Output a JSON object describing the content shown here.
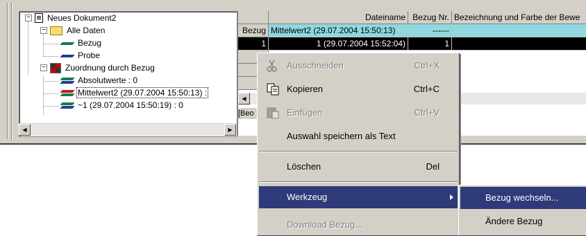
{
  "tree": {
    "nodes": [
      {
        "label": "Neues Dokument2",
        "icon": "document-icon"
      },
      {
        "label": "Alle Daten",
        "icon": "folder-icon"
      },
      {
        "label": "Bezug",
        "icon": "dataset-icon"
      },
      {
        "label": "Probe",
        "icon": "dataset-icon"
      },
      {
        "label": "Zuordnung durch Bezug",
        "icon": "grid-icon"
      },
      {
        "label": "Absolutwerte : 0",
        "icon": "dataset-icon"
      },
      {
        "label": "Mittelwert2 (29.07.2004 15:50:13) :",
        "icon": "dataset-icon"
      },
      {
        "label": "~1 (29.07.2004 15:50:19) : 0",
        "icon": "dataset-icon"
      }
    ]
  },
  "grid": {
    "headers": [
      "Dateiname",
      "Bezug Nr.",
      "Bezeichnung und Farbe der Bewe"
    ],
    "rows": [
      {
        "rowlabel": "Bezug",
        "name": "Mittelwert2 (29.07.2004 15:50:13)",
        "nr": "------"
      },
      {
        "rowlabel": "1",
        "name": "1 (29.07.2004 15:52:04)",
        "nr": "1"
      }
    ],
    "status_text": "[Beo"
  },
  "context_menu": {
    "items": [
      {
        "label": "Ausschneiden",
        "shortcut": "Ctrl+X",
        "enabled": false
      },
      {
        "label": "Kopieren",
        "shortcut": "Ctrl+C",
        "enabled": true
      },
      {
        "label": "Einfügen",
        "shortcut": "Ctrl+V",
        "enabled": false
      },
      {
        "label": "Auswahl speichern als Text",
        "shortcut": "",
        "enabled": true
      },
      {
        "label": "Löschen",
        "shortcut": "Del",
        "enabled": true
      },
      {
        "label": "Werkzeug",
        "shortcut": "",
        "enabled": true,
        "highlighted": true,
        "has_submenu": true
      },
      {
        "label": "Download Bezug...",
        "shortcut": "",
        "enabled": false
      }
    ]
  },
  "submenu": {
    "items": [
      {
        "label": "Bezug wechseln...",
        "highlighted": true
      },
      {
        "label": "Ändere Bezug",
        "highlighted": false
      }
    ]
  },
  "colors": {
    "highlight": "#2f3a7a",
    "bezug_row": "#8fd8e0",
    "selected_row": "#000000",
    "face": "#d4d0c8"
  }
}
